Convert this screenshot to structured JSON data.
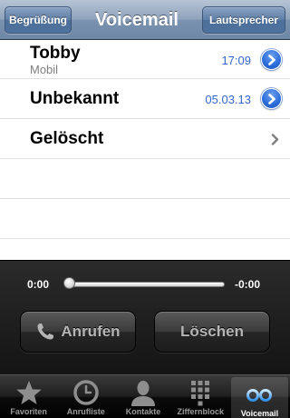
{
  "navbar": {
    "left_button": "Begrüßung",
    "title": "Voicemail",
    "right_button": "Lautsprecher"
  },
  "list": {
    "items": [
      {
        "name": "Tobby",
        "subtitle": "Mobil",
        "time": "17:09"
      },
      {
        "name": "Unbekannt",
        "time": "05.03.13"
      },
      {
        "name": "Gelöscht"
      }
    ]
  },
  "player": {
    "elapsed": "0:00",
    "remaining": "-0:00",
    "progress": 0,
    "call_button": "Anrufen",
    "delete_button": "Löschen"
  },
  "tabbar": {
    "tabs": [
      {
        "label": "Favoriten",
        "icon": "star-icon"
      },
      {
        "label": "Anrufliste",
        "icon": "clock-icon"
      },
      {
        "label": "Kontakte",
        "icon": "person-icon"
      },
      {
        "label": "Ziffernblock",
        "icon": "keypad-icon"
      },
      {
        "label": "Voicemail",
        "icon": "voicemail-icon",
        "active": true
      }
    ]
  },
  "colors": {
    "accent": "#2e6fdc",
    "time_text": "#3266cc"
  }
}
